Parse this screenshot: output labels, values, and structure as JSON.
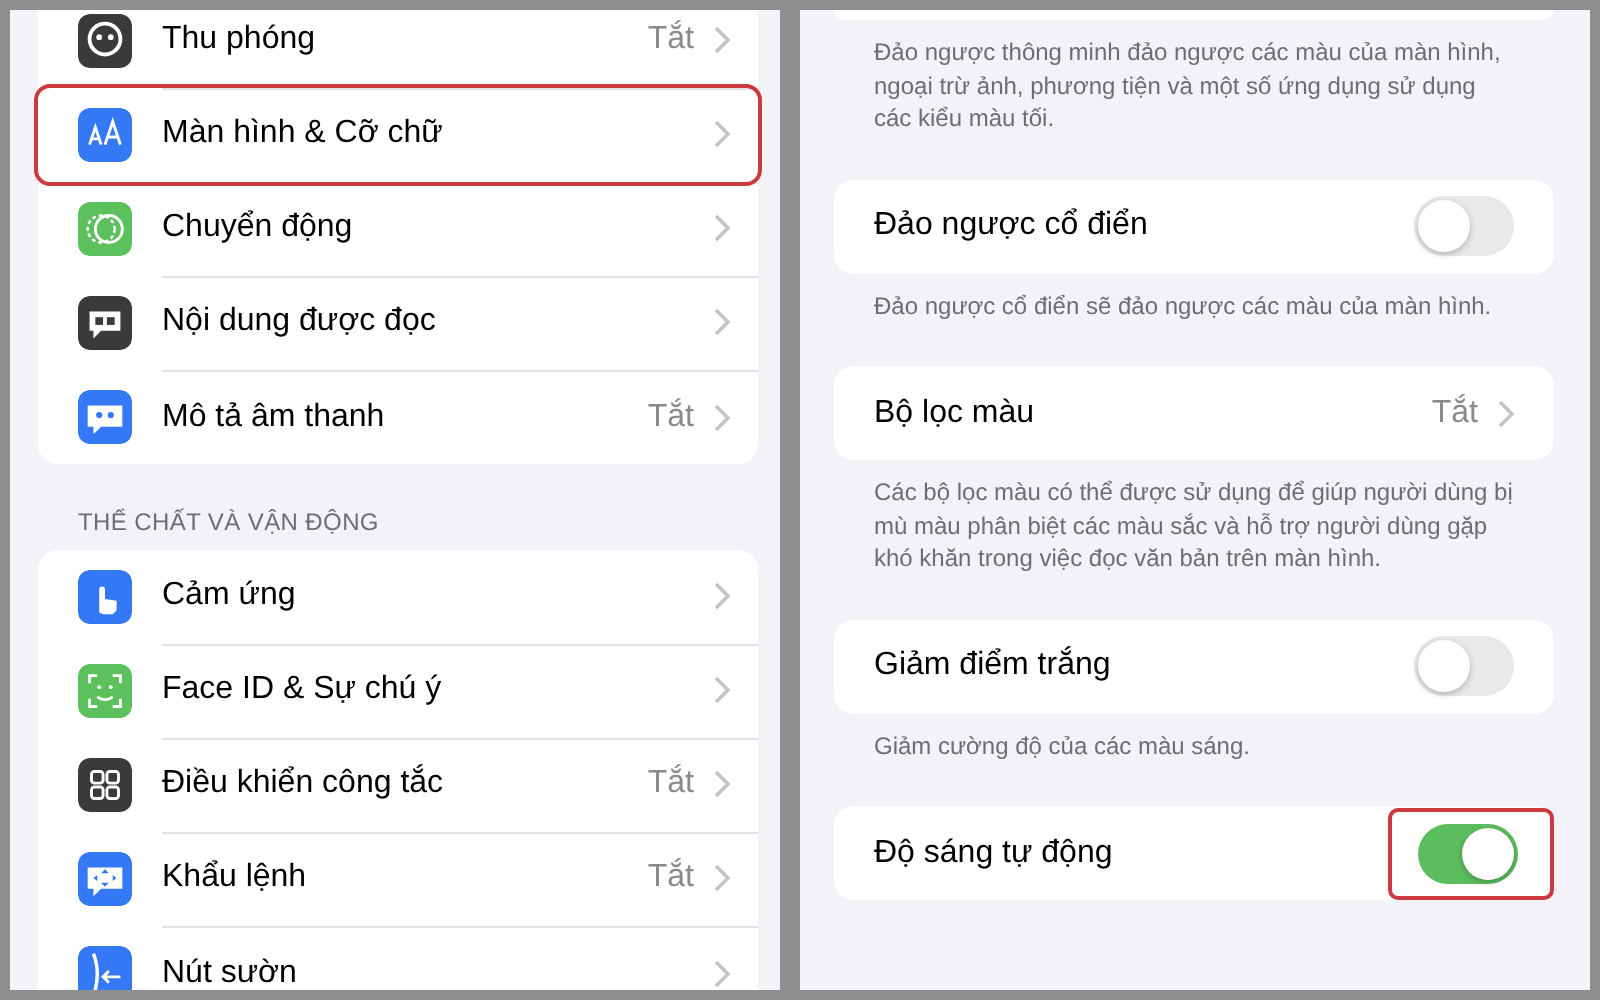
{
  "left_panel": {
    "groups": [
      {
        "items": [
          {
            "label": "Thu phóng",
            "value": "Tắt",
            "color": "#3a3a3c",
            "highlighted": false
          },
          {
            "label": "Màn hình & Cỡ chữ",
            "value": null,
            "color": "#3478f6",
            "highlighted": true
          },
          {
            "label": "Chuyển động",
            "value": null,
            "color": "#5cc05c",
            "highlighted": false
          },
          {
            "label": "Nội dung được đọc",
            "value": null,
            "color": "#3a3a3c",
            "highlighted": false
          },
          {
            "label": "Mô tả âm thanh",
            "value": "Tắt",
            "color": "#3478f6",
            "highlighted": false
          }
        ]
      },
      {
        "header": "THỂ CHẤT VÀ VẬN ĐỘNG",
        "items": [
          {
            "label": "Cảm ứng",
            "value": null,
            "color": "#3478f6",
            "highlighted": false
          },
          {
            "label": "Face ID & Sự chú ý",
            "value": null,
            "color": "#5cc05c",
            "highlighted": false
          },
          {
            "label": "Điều khiển công tắc",
            "value": "Tắt",
            "color": "#3a3a3c",
            "highlighted": false
          },
          {
            "label": "Khẩu lệnh",
            "value": "Tắt",
            "color": "#3478f6",
            "highlighted": false
          },
          {
            "label": "Nút sườn",
            "value": null,
            "color": "#3478f6",
            "highlighted": false
          }
        ]
      }
    ]
  },
  "right_panel": {
    "sections": [
      {
        "footer": "Đảo ngược thông minh đảo ngược các màu của màn hình, ngoại trừ ảnh, phương tiện và một số ứng dụng sử dụng các kiểu màu tối."
      },
      {
        "row": {
          "kind": "toggle",
          "label": "Đảo ngược cổ điển",
          "on": false,
          "highlighted": false
        },
        "footer": "Đảo ngược cổ điển sẽ đảo ngược các màu của màn hình."
      },
      {
        "row": {
          "kind": "link",
          "label": "Bộ lọc màu",
          "value": "Tắt"
        },
        "footer": "Các bộ lọc màu có thể được sử dụng để giúp người dùng bị mù màu phân biệt các màu sắc và hỗ trợ người dùng gặp khó khăn trong việc đọc văn bản trên màn hình."
      },
      {
        "row": {
          "kind": "toggle",
          "label": "Giảm điểm trắng",
          "on": false,
          "highlighted": false
        },
        "footer": "Giảm cường độ của các màu sáng."
      },
      {
        "row": {
          "kind": "toggle",
          "label": "Độ sáng tự động",
          "on": true,
          "highlighted": true
        }
      }
    ]
  }
}
